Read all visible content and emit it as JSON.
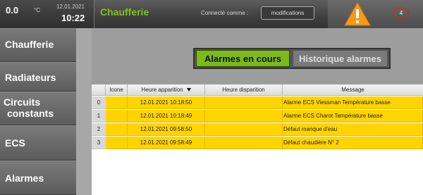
{
  "header": {
    "temperature": "0.0",
    "temperature_unit": "°C",
    "date": "12.01.2021",
    "time": "10:22",
    "title": "Chaufferie",
    "connected_label": "Connecté comme :",
    "modifications_button": "modifications",
    "alarm_count": "4",
    "title_color": "#7ec41d"
  },
  "sidebar": {
    "items": [
      {
        "label": "Chaufferie"
      },
      {
        "label": "Radiateurs"
      },
      {
        "label": "Circuits"
      },
      {
        "label": "constants"
      },
      {
        "label": "ECS"
      },
      {
        "label": "Alarmes"
      }
    ]
  },
  "tabs": {
    "active": "Alarmes en cours",
    "inactive": "Historique alarmes",
    "active_color": "#7cb91a"
  },
  "table": {
    "headers": {
      "icon": "Icone",
      "appearance": "Heure apparition",
      "disappearance": "Heure disparition",
      "message": "Message"
    },
    "row_color": "#ffd400",
    "rows": [
      {
        "index": "0",
        "appearance": "12.01.2021 10:18:50",
        "disappearance": "",
        "message": "Alarme ECS Viessman Température basse"
      },
      {
        "index": "1",
        "appearance": "12.01.2021 10:18:49",
        "disappearance": "",
        "message": "Alarme ECS Charot Température basse"
      },
      {
        "index": "2",
        "appearance": "12.01.2021 09:58:50",
        "disappearance": "",
        "message": "Défaut manque d'eau"
      },
      {
        "index": "3",
        "appearance": "12.01.2021 09:58:49",
        "disappearance": "",
        "message": "Défaut chaudière N° 2"
      }
    ]
  }
}
